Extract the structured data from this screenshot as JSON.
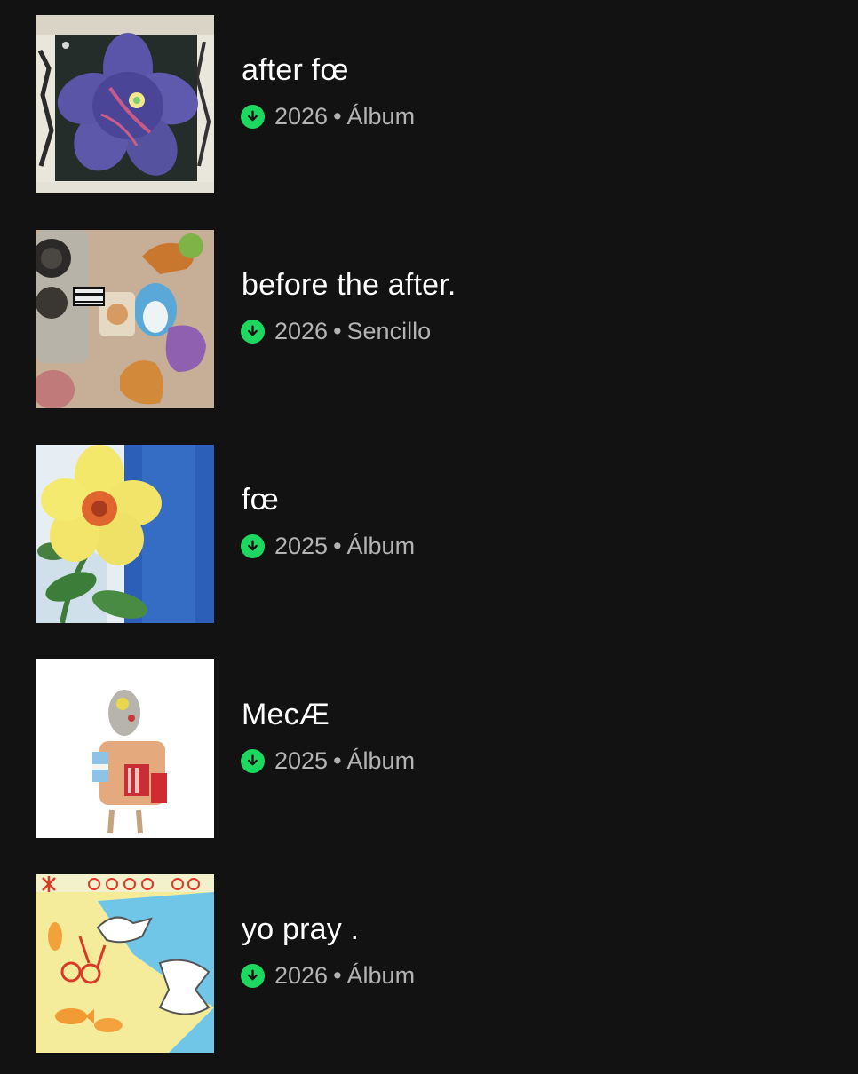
{
  "colors": {
    "background": "#121212",
    "title": "#ffffff",
    "meta": "#b3b3b3",
    "downloaded": "#1ed760"
  },
  "items": [
    {
      "title": "after fœ",
      "year": "2026",
      "separator": "•",
      "type": "Álbum",
      "icon": "download-icon"
    },
    {
      "title": "before the after.",
      "year": "2026",
      "separator": "•",
      "type": "Sencillo",
      "icon": "download-icon"
    },
    {
      "title": "fœ",
      "year": "2025",
      "separator": "•",
      "type": "Álbum",
      "icon": "download-icon"
    },
    {
      "title": "MecÆ",
      "year": "2025",
      "separator": "•",
      "type": "Álbum",
      "icon": "download-icon"
    },
    {
      "title": "yo pray .",
      "year": "2026",
      "separator": "•",
      "type": "Álbum",
      "icon": "download-icon"
    }
  ]
}
